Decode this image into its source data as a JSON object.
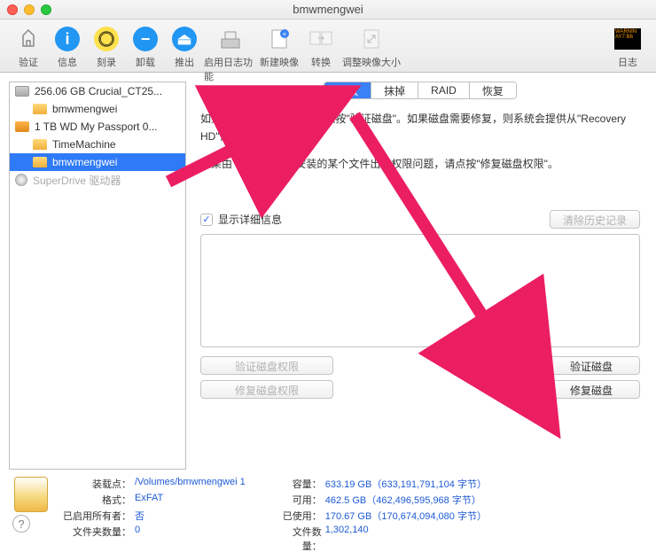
{
  "window": {
    "title": "bmwmengwei"
  },
  "toolbar": {
    "items": [
      {
        "label": "验证"
      },
      {
        "label": "信息"
      },
      {
        "label": "刻录"
      },
      {
        "label": "卸载"
      },
      {
        "label": "推出"
      },
      {
        "label": "启用日志功能"
      },
      {
        "label": "新建映像"
      },
      {
        "label": "转换"
      },
      {
        "label": "调整映像大小"
      }
    ],
    "log": "日志"
  },
  "sidebar": {
    "items": [
      {
        "label": "256.06 GB Crucial_CT25..."
      },
      {
        "label": "bmwmengwei"
      },
      {
        "label": "1 TB WD My Passport 0..."
      },
      {
        "label": "TimeMachine"
      },
      {
        "label": "bmwmengwei"
      },
      {
        "label": "SuperDrive 驱动器"
      }
    ]
  },
  "tabs": {
    "first_aid": "急救",
    "erase": "抹掉",
    "raid": "RAID",
    "restore": "恢复"
  },
  "desc": {
    "line1a": "如果\"修复磁盘\"不可用，请点按\"验证磁盘\"。如果磁盘需要修复，则系统会提供从\"Recovery HD\"修复磁盘的说明。",
    "line2": "如果由 OS X 安装器安装的某个文件出现权限问题，请点按\"修复磁盘权限\"。"
  },
  "detail": {
    "checkbox_label": "显示详细信息",
    "clear_btn": "清除历史记录"
  },
  "buttons": {
    "verify_perm": "验证磁盘权限",
    "verify_disk": "验证磁盘",
    "repair_perm": "修复磁盘权限",
    "repair_disk": "修复磁盘"
  },
  "info": {
    "left": {
      "mount_k": "装载点：",
      "mount_v": "/Volumes/bmwmengwei 1",
      "format_k": "格式：",
      "format_v": "ExFAT",
      "owners_k": "已启用所有者：",
      "owners_v": "否",
      "folders_k": "文件夹数量：",
      "folders_v": "0"
    },
    "right": {
      "cap_k": "容量：",
      "cap_v": "633.19 GB（633,191,791,104 字节）",
      "avail_k": "可用：",
      "avail_v": "462.5 GB（462,496,595,968 字节）",
      "used_k": "已使用：",
      "used_v": "170.67 GB（170,674,094,080 字节）",
      "files_k": "文件数量：",
      "files_v": "1,302,140"
    }
  }
}
